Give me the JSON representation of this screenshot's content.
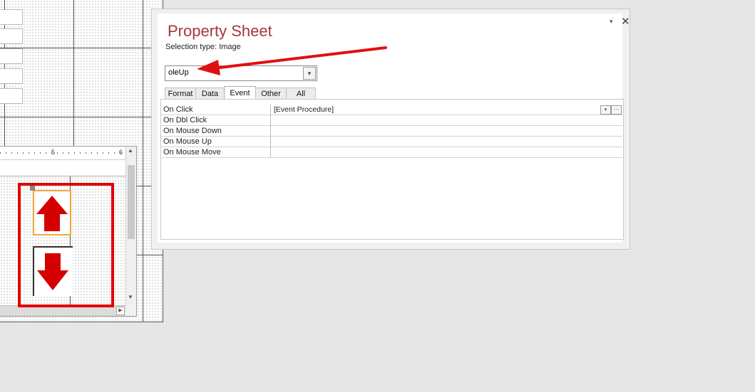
{
  "property_sheet": {
    "title": "Property Sheet",
    "selection_type": "Selection type:  Image",
    "selected_object": "oleUp",
    "pin_icon": "▾",
    "close_icon": "✕",
    "tabs": [
      "Format",
      "Data",
      "Event",
      "Other",
      "All"
    ],
    "active_tab": "Event",
    "properties": [
      {
        "label": "On Click",
        "value": "[Event Procedure]"
      },
      {
        "label": "On Dbl Click",
        "value": ""
      },
      {
        "label": "On Mouse Down",
        "value": ""
      },
      {
        "label": "On Mouse Up",
        "value": ""
      },
      {
        "label": "On Mouse Move",
        "value": ""
      }
    ],
    "builder_button": "···",
    "dropdown_glyph": "▾"
  },
  "design_view": {
    "ruler_numbers": [
      "5",
      "6"
    ],
    "images": [
      {
        "name": "oleUp",
        "icon": "arrow-up-icon",
        "color": "#d40000"
      },
      {
        "name": "oleDown",
        "icon": "arrow-down-icon",
        "color": "#d40000"
      }
    ]
  },
  "annotation": {
    "arrow_color": "#e01010",
    "frame_color": "#e00000"
  }
}
